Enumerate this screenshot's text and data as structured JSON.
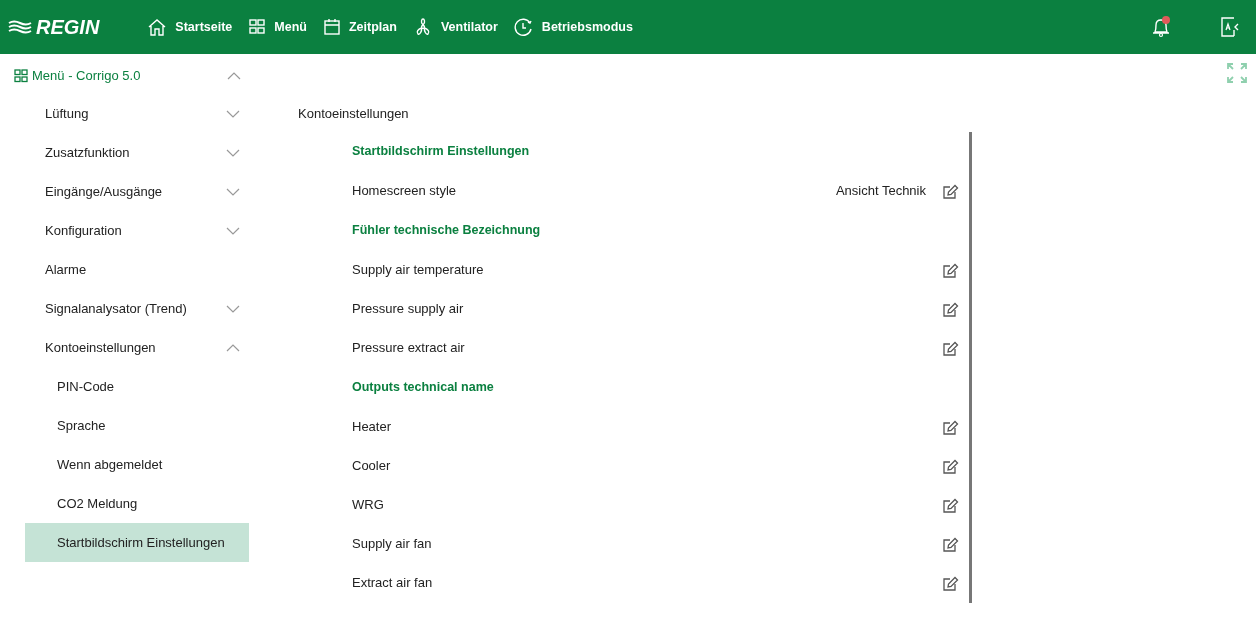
{
  "header": {
    "logo": "REGIN",
    "nav": [
      {
        "label": "Startseite"
      },
      {
        "label": "Menü"
      },
      {
        "label": "Zeitplan"
      },
      {
        "label": "Ventilator"
      },
      {
        "label": "Betriebsmodus"
      }
    ],
    "notifications": {
      "unread": true
    }
  },
  "sidebar": {
    "root": {
      "label": "Menü - Corrigo 5.0",
      "expanded": true,
      "children": [
        {
          "label": "Lüftung",
          "expanded": false,
          "selected": false
        },
        {
          "label": "Zusatzfunktion",
          "expanded": false,
          "selected": false
        },
        {
          "label": "Eingänge/Ausgänge",
          "expanded": false,
          "selected": false
        },
        {
          "label": "Konfiguration",
          "expanded": false,
          "selected": false
        },
        {
          "label": "Alarme",
          "selected": false
        },
        {
          "label": "Signalanalysator (Trend)",
          "expanded": false,
          "selected": false
        },
        {
          "label": "Kontoeinstellungen",
          "expanded": true,
          "selected": false,
          "children": [
            {
              "label": "PIN-Code",
              "selected": false
            },
            {
              "label": "Sprache",
              "selected": false
            },
            {
              "label": "Wenn abgemeldet",
              "selected": false
            },
            {
              "label": "CO2 Meldung",
              "selected": false
            },
            {
              "label": "Startbildschirm Einstellungen",
              "selected": true
            }
          ]
        }
      ]
    }
  },
  "content": {
    "breadcrumb": "Kontoeinstellungen",
    "rows": [
      {
        "kind": "heading",
        "label": "Startbildschirm Einstellungen"
      },
      {
        "kind": "setting",
        "label": "Homescreen style",
        "value": "Ansicht Technik"
      },
      {
        "kind": "heading",
        "label": "Fühler technische Bezeichnung"
      },
      {
        "kind": "setting",
        "label": "Supply air temperature"
      },
      {
        "kind": "setting",
        "label": "Pressure supply air"
      },
      {
        "kind": "setting",
        "label": "Pressure extract air"
      },
      {
        "kind": "heading",
        "label": "Outputs technical name"
      },
      {
        "kind": "setting",
        "label": "Heater"
      },
      {
        "kind": "setting",
        "label": "Cooler"
      },
      {
        "kind": "setting",
        "label": "WRG"
      },
      {
        "kind": "setting",
        "label": "Supply air fan"
      },
      {
        "kind": "setting",
        "label": "Extract air fan"
      }
    ]
  }
}
